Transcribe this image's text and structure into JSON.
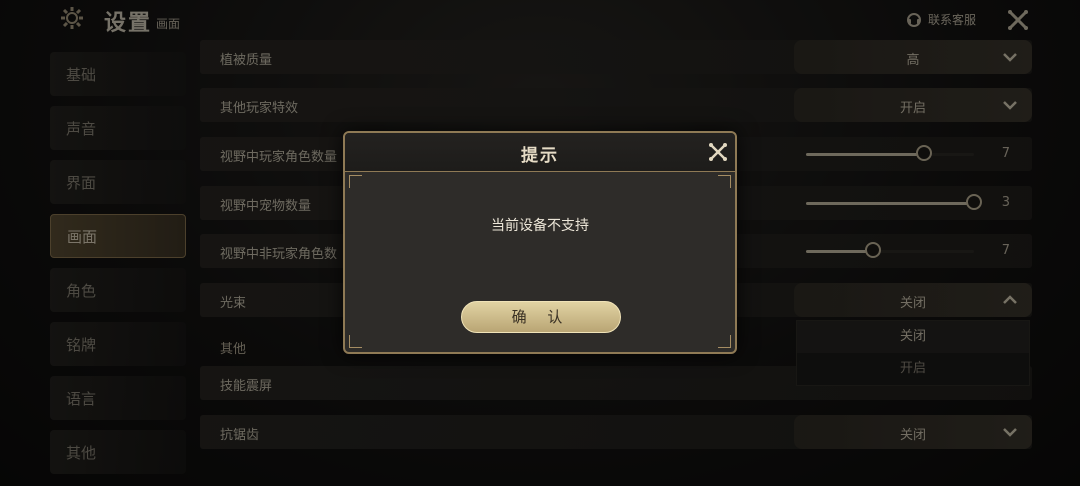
{
  "header": {
    "title": "设置",
    "subtitle": "画面",
    "support_label": "联系客服"
  },
  "sidebar": {
    "items": [
      {
        "label": "基础"
      },
      {
        "label": "声音"
      },
      {
        "label": "界面"
      },
      {
        "label": "画面"
      },
      {
        "label": "角色"
      },
      {
        "label": "铭牌"
      },
      {
        "label": "语言"
      },
      {
        "label": "其他"
      }
    ],
    "active": "画面"
  },
  "settings": {
    "rows": [
      {
        "label": "植被质量",
        "value": "高"
      },
      {
        "label": "其他玩家特效",
        "value": "开启"
      },
      {
        "label": "视野中玩家角色数量",
        "value": "7",
        "slider_level": 0.7
      },
      {
        "label": "视野中宠物数量",
        "value": "3",
        "slider_level": 1.0
      },
      {
        "label": "视野中非玩家角色数",
        "value": "7",
        "slider_level": 0.4
      },
      {
        "label": "光束",
        "value": "关闭"
      },
      {
        "label": "技能震屏",
        "value": ""
      },
      {
        "label": "抗锯齿",
        "value": "关闭"
      }
    ],
    "section_other": "其他",
    "dropdown_options": [
      "关闭",
      "开启"
    ]
  },
  "modal": {
    "title": "提示",
    "message": "当前设备不支持",
    "confirm_label": "确 认"
  },
  "colors": {
    "accent_gold": "#8f7a55",
    "button_gold": "#d4c393"
  }
}
